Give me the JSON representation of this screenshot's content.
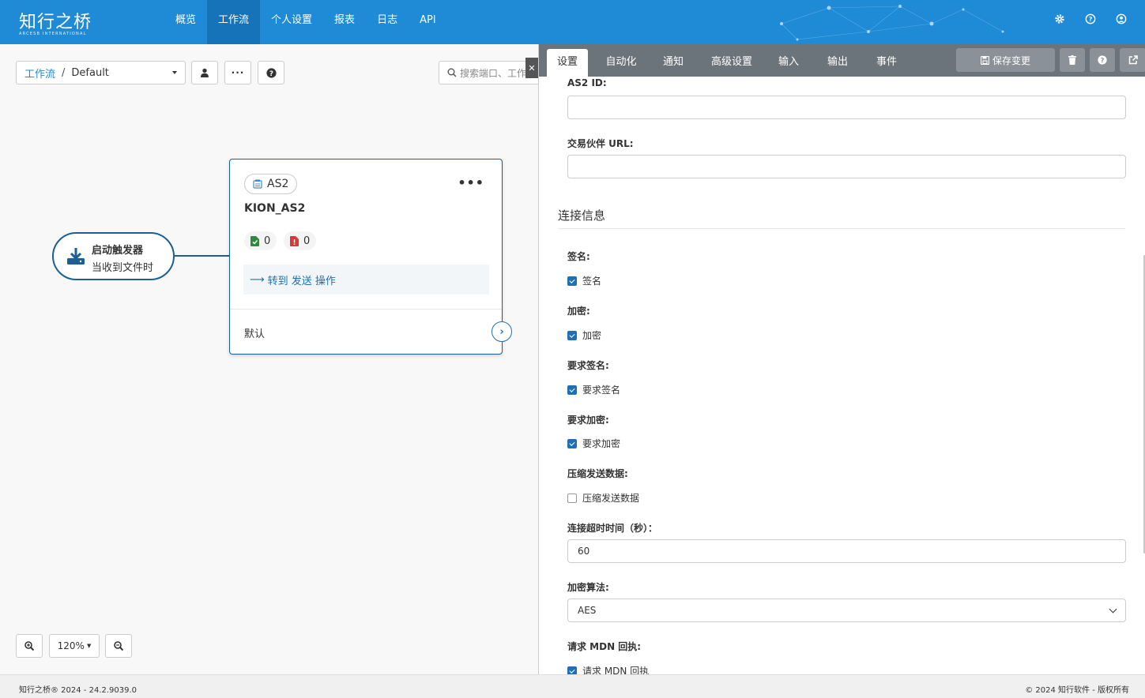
{
  "app": {
    "logo_text": "知行之桥",
    "logo_subtext": "ARCESB INTERNATIONAL"
  },
  "nav": {
    "items": [
      {
        "label": "概览",
        "active": false
      },
      {
        "label": "工作流",
        "active": true
      },
      {
        "label": "个人设置",
        "active": false
      },
      {
        "label": "报表",
        "active": false
      },
      {
        "label": "日志",
        "active": false
      },
      {
        "label": "API",
        "active": false
      }
    ],
    "icons": [
      "gear-icon",
      "help-icon",
      "user-icon"
    ]
  },
  "canvas": {
    "breadcrumb_link": "工作流",
    "breadcrumb_sep": "/",
    "breadcrumb_current": "Default",
    "search_placeholder": "搜索端口、工作流",
    "trigger": {
      "title": "启动触发器",
      "subtitle": "当收到文件时"
    },
    "connector_card": {
      "type_label": "AS2",
      "name": "KION_AS2",
      "success_count": "0",
      "error_count": "0",
      "goto_text": "转到 发送 操作",
      "default_label": "默认"
    },
    "zoom_level": "120%"
  },
  "panel": {
    "tabs": [
      {
        "label": "设置",
        "active": true
      },
      {
        "label": "自动化",
        "active": false
      },
      {
        "label": "通知",
        "active": false
      },
      {
        "label": "高级设置",
        "active": false
      },
      {
        "label": "输入",
        "active": false
      },
      {
        "label": "输出",
        "active": false
      },
      {
        "label": "事件",
        "active": false
      }
    ],
    "save_label": "保存变更",
    "fields": {
      "as2_id_label": "AS2 ID:",
      "as2_id_value": "",
      "partner_url_label": "交易伙伴 URL:",
      "partner_url_value": "",
      "section_title": "连接信息",
      "sign_label": "签名:",
      "sign_cb": "签名",
      "sign_checked": true,
      "encrypt_label": "加密:",
      "encrypt_cb": "加密",
      "encrypt_checked": true,
      "require_sign_label": "要求签名:",
      "require_sign_cb": "要求签名",
      "require_sign_checked": true,
      "require_encrypt_label": "要求加密:",
      "require_encrypt_cb": "要求加密",
      "require_encrypt_checked": true,
      "compress_label": "压缩发送数据:",
      "compress_cb": "压缩发送数据",
      "compress_checked": false,
      "timeout_label": "连接超时时间（秒）：",
      "timeout_value": "60",
      "algo_label": "加密算法:",
      "algo_value": "AES",
      "mdn_label": "请求 MDN 回执:",
      "mdn_cb": "请求 MDN 回执",
      "mdn_checked": true
    }
  },
  "footer": {
    "left": "知行之桥® 2024 - 24.2.9039.0",
    "right": "© 2024 知行软件 - 版权所有"
  },
  "colors": {
    "navbar": "#1f8ad6",
    "nav_active": "#1673b9",
    "accent": "#1f6fb4",
    "panel_tabbar": "#6c747b",
    "success": "#2e8b3e",
    "error": "#d33a3a"
  }
}
